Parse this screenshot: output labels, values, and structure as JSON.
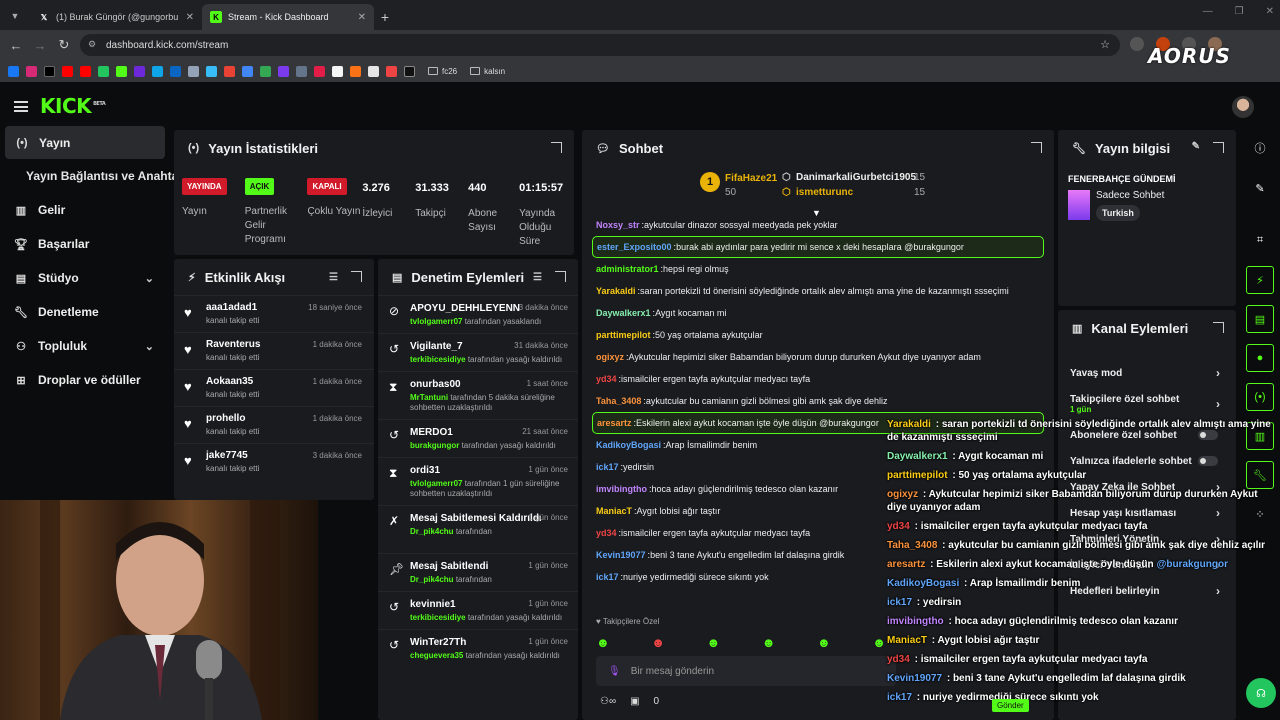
{
  "browser": {
    "tabs": [
      {
        "label": "(1) Burak Güngör (@gungorbu",
        "icon": "x-logo-icon"
      },
      {
        "label": "Stream - Kick Dashboard",
        "icon": "kick-favicon-icon"
      }
    ],
    "new_tab": "+",
    "url": "dashboard.kick.com/stream",
    "bookmarks_folders": [
      "fc26",
      "kalsın"
    ]
  },
  "overlay_brand": "AORUS",
  "kick": {
    "logo": "KICK",
    "logo_sup": "BETA"
  },
  "sidebar": {
    "items": [
      {
        "label": "Yayın",
        "icon": "broadcast-icon"
      },
      {
        "label": "Yayın Bağlantısı ve Anahtarı",
        "icon": ""
      },
      {
        "label": "Gelir",
        "icon": "revenue-icon"
      },
      {
        "label": "Başarılar",
        "icon": "trophy-icon"
      },
      {
        "label": "Stüdyo",
        "icon": "studio-icon"
      },
      {
        "label": "Denetleme",
        "icon": "wrench-icon"
      },
      {
        "label": "Topluluk",
        "icon": "community-icon"
      },
      {
        "label": "Droplar ve ödüller",
        "icon": "drops-icon"
      }
    ]
  },
  "stats": {
    "title": "Yayın İstatistikleri",
    "items": [
      {
        "badge": "YAYINDA",
        "label": "Yayın"
      },
      {
        "badge": "AÇIK",
        "label": "Partnerlik Gelir Programı"
      },
      {
        "badge": "KAPALI",
        "label": "Çoklu Yayın"
      },
      {
        "value": "3.276",
        "label": "İzleyici"
      },
      {
        "value": "31.333",
        "label": "Takipçi"
      },
      {
        "value": "440",
        "label": "Abone Sayısı"
      },
      {
        "value": "01:15:57",
        "label": "Yayında Olduğu Süre"
      }
    ]
  },
  "activity": {
    "title": "Etkinlik Akışı",
    "items": [
      {
        "name": "aaa1adad1",
        "sub": "kanalı takip etti",
        "time": "18 saniye önce"
      },
      {
        "name": "Raventerus",
        "sub": "kanalı takip etti",
        "time": "1 dakika önce"
      },
      {
        "name": "Aokaan35",
        "sub": "kanalı takip etti",
        "time": "1 dakika önce"
      },
      {
        "name": "prohello",
        "sub": "kanalı takip etti",
        "time": "1 dakika önce"
      },
      {
        "name": "jake7745",
        "sub": "kanalı takip etti",
        "time": "3 dakika önce"
      }
    ]
  },
  "moderation": {
    "title": "Denetim Eylemleri",
    "items": [
      {
        "name": "APOYU_DEHHLEYENN",
        "user": "tvlolgamerr07",
        "sub": "tarafından yasaklandı",
        "time": "3 dakika önce",
        "icon": "ban-icon"
      },
      {
        "name": "Vigilante_7",
        "user": "terkibicesidiye",
        "sub": "tarafından yasağı kaldırıldı",
        "time": "31 dakika önce",
        "icon": "unban-icon"
      },
      {
        "name": "onurbas00",
        "user": "MrTantuni",
        "sub": "tarafından 5 dakika süreliğine sohbetten uzaklaştırıldı",
        "time": "1 saat önce",
        "icon": "hourglass-icon"
      },
      {
        "name": "MERDO1",
        "user": "burakgungor",
        "sub": "tarafından yasağı kaldırıldı",
        "time": "21 saat önce",
        "icon": "unban-icon"
      },
      {
        "name": "ordi31",
        "user": "tvlolgamerr07",
        "sub": "tarafından 1 gün süreliğine sohbetten uzaklaştırıldı",
        "time": "1 gün önce",
        "icon": "hourglass-icon"
      },
      {
        "name": "Mesaj Sabitlemesi Kaldırıldı",
        "user": "Dr_pik4chu",
        "sub": "tarafından",
        "time": "1 gün önce",
        "icon": "unpin-icon"
      },
      {
        "name": "Mesaj Sabitlendi",
        "user": "Dr_pik4chu",
        "sub": "tarafından",
        "time": "1 gün önce",
        "icon": "pin-icon"
      },
      {
        "name": "kevinnie1",
        "user": "terkibicesidiye",
        "sub": "tarafından yasağı kaldırıldı",
        "time": "1 gün önce",
        "icon": "unban-icon"
      },
      {
        "name": "WinTer27Th",
        "user": "cheguevera35",
        "sub": "tarafından yasağı kaldırıldı",
        "time": "1 gün önce",
        "icon": "unban-icon"
      }
    ]
  },
  "chat": {
    "title": "Sohbet",
    "leaders": [
      {
        "rank": "1",
        "name": "FifaHaze21",
        "count": "50"
      },
      {
        "name": "DanimarkaliGurbetci1905",
        "count": "15"
      },
      {
        "name": "ismetturunc",
        "count": "15"
      }
    ],
    "messages": [
      {
        "user": "Noxsy_str",
        "color": "#c084fc",
        "text": "aykutcular dinazor sossyal meedyada pek yoklar"
      },
      {
        "user": "ester_Exposito00",
        "color": "#60a5fa",
        "text": "burak abi aydınlar para yedirir mi sence x deki hesaplara @burakgungor",
        "hl": true
      },
      {
        "user": "administrator1",
        "color": "#53fc18",
        "text": "hepsi regi olmuş"
      },
      {
        "user": "Yarakaldi",
        "color": "#facc15",
        "text": "saran portekizli td önerisini söylediğinde ortalık alev almıştı ama yine de kazanmıştı ssseçimi"
      },
      {
        "user": "Daywalkerx1",
        "color": "#86efac",
        "text": "Aygıt kocaman mi"
      },
      {
        "user": "parttimepilot",
        "color": "#facc15",
        "text": "50 yaş ortalama aykutçular"
      },
      {
        "user": "ogixyz",
        "color": "#fb923c",
        "text": "Aykutcular hepimizi siker Babamdan biliyorum durup dururken Aykut diye uyanıyor adam"
      },
      {
        "user": "yd34",
        "color": "#ef4444",
        "text": "ismailciler ergen tayfa aykutçular medyacı tayfa"
      },
      {
        "user": "Taha_3408",
        "color": "#fb923c",
        "text": "aykutcular bu camianın gizli bölmesi gibi amk şak diye dehliz"
      },
      {
        "user": "aresartz",
        "color": "#fb923c",
        "text": "Eskilerin alexi aykut kocaman işte öyle düşün @burakgungor",
        "hl": true
      },
      {
        "user": "KadikoyBogasi",
        "color": "#60a5fa",
        "text": "Arap İsmailimdir benim"
      },
      {
        "user": "ick17",
        "color": "#60a5fa",
        "text": "yedirsin"
      },
      {
        "user": "imvibingtho",
        "color": "#c084fc",
        "text": "hoca adayı güçlendirilmiş tedesco olan kazanır"
      },
      {
        "user": "ManiacT",
        "color": "#facc15",
        "text": "Aygıt lobisi ağır taştır"
      },
      {
        "user": "yd34",
        "color": "#ef4444",
        "text": "ismailciler ergen tayfa aykutçular medyacı tayfa"
      },
      {
        "user": "Kevin19077",
        "color": "#60a5fa",
        "text": "beni 3 tane Aykut'u engelledim laf dalaşına girdik"
      },
      {
        "user": "ick17",
        "color": "#60a5fa",
        "text": "nuriye yedirmediği sürece sıkıntı yok"
      }
    ],
    "followers_only": "Takipçilere Özel",
    "input_placeholder": "Bir mesaj gönderin",
    "viewer_count": "0"
  },
  "stream_info": {
    "title": "Yayın bilgisi",
    "stream_title": "FENERBAHÇE GÜNDEMİ",
    "category": "Sadece Sohbet",
    "tag": "Turkish"
  },
  "channel_actions": {
    "title": "Kanal Eylemleri",
    "items": [
      {
        "label": "Yavaş mod",
        "type": "chevron"
      },
      {
        "label": "Takipçilere özel sohbet",
        "sub": "1 gün",
        "type": "chevron"
      },
      {
        "label": "Abonelere özel sohbet",
        "type": "toggle"
      },
      {
        "label": "Yalnızca ifadelerle sohbet",
        "type": "toggle"
      },
      {
        "label": "Yapay Zeka ile Sohbet",
        "type": "chevron"
      },
      {
        "label": "Hesap yaşı kısıtlaması",
        "type": "chevron"
      },
      {
        "label": "Tahminleri Yönetin",
        "type": "chevron"
      },
      {
        "label": "İzleyici Yönlendir",
        "type": "chevron"
      },
      {
        "label": "Hedefleri belirleyin",
        "type": "chevron"
      }
    ]
  },
  "overlay_chat": [
    {
      "user": "Yarakaldi",
      "color": "#facc15",
      "text": "saran portekizli td önerisini söylediğinde ortalık alev almıştı ama yine de kazanmıştı ssseçimi"
    },
    {
      "user": "Daywalkerx1",
      "color": "#86efac",
      "text": "Aygıt kocaman mi"
    },
    {
      "user": "parttimepilot",
      "color": "#facc15",
      "text": "50 yaş ortalama aykutçular"
    },
    {
      "user": "ogixyz",
      "color": "#fb923c",
      "text": "Aykutcular hepimizi siker Babamdan biliyorum durup dururken Aykut diye uyanıyor adam"
    },
    {
      "user": "yd34",
      "color": "#ef4444",
      "text": "ismailciler ergen tayfa aykutçular medyacı tayfa"
    },
    {
      "user": "Taha_3408",
      "color": "#fb923c",
      "text": "aykutcular bu camianın gizli bölmesi gibi amk şak diye dehliz açılır"
    },
    {
      "user": "aresartz",
      "color": "#fb923c",
      "text": "Eskilerin alexi aykut kocaman işte öyle düşün",
      "mention": "@burakgungor"
    },
    {
      "user": "KadikoyBogasi",
      "color": "#60a5fa",
      "text": "Arap İsmailimdir benim"
    },
    {
      "user": "ick17",
      "color": "#60a5fa",
      "text": "yedirsin"
    },
    {
      "user": "imvibingtho",
      "color": "#c084fc",
      "text": "hoca adayı güçlendirilmiş tedesco olan kazanır"
    },
    {
      "user": "ManiacT",
      "color": "#facc15",
      "text": "Aygıt lobisi ağır taştır"
    },
    {
      "user": "yd34",
      "color": "#ef4444",
      "text": "ismailciler ergen tayfa aykutçular medyacı tayfa"
    },
    {
      "user": "Kevin19077",
      "color": "#60a5fa",
      "text": "beni 3 tane Aykut'u engelledim laf dalaşına girdik"
    },
    {
      "user": "ick17",
      "color": "#60a5fa",
      "text": "nuriye yedirmediği sürece sıkıntı yok"
    }
  ],
  "overlay_chat_send": "Gönder",
  "colors": {
    "accent": "#53fc18",
    "panel": "#191b1f",
    "live": "#d11a2a"
  }
}
